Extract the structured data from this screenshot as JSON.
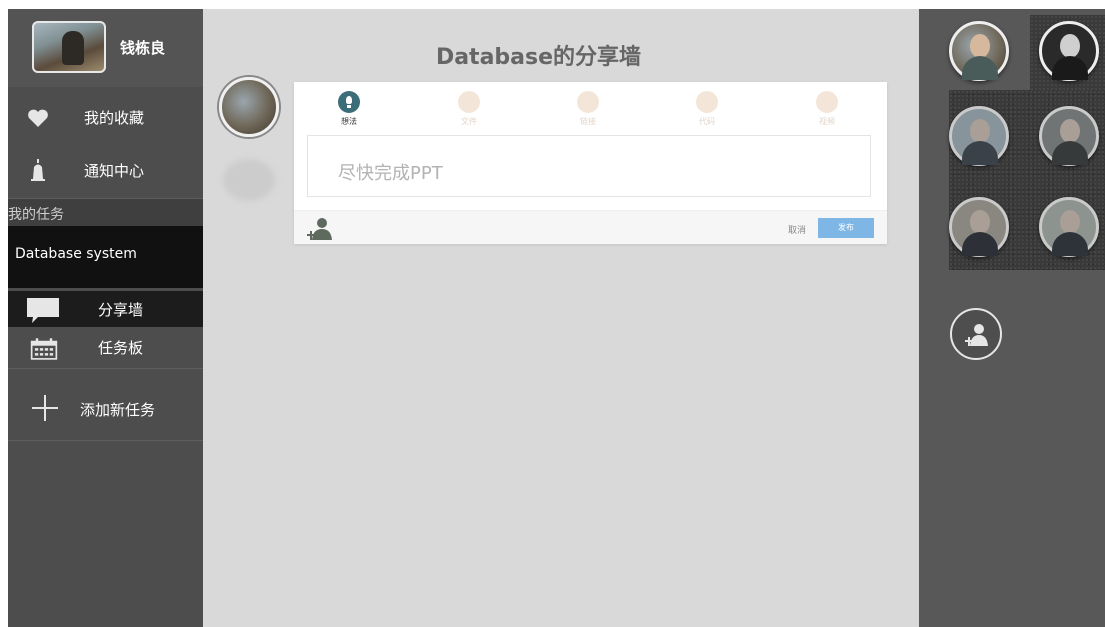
{
  "sidebar": {
    "user_name": "钱栋良",
    "favorites_label": "我的收藏",
    "notifications_label": "通知中心",
    "section_title": "我的任务",
    "active_task": "Database system",
    "share_wall_label": "分享墙",
    "task_board_label": "任务板",
    "add_task_label": "添加新任务"
  },
  "main": {
    "title": "Database的分享墙",
    "composer": {
      "tabs": [
        {
          "label": "想法",
          "icon": "lightbulb-icon",
          "active": true
        },
        {
          "label": "文件",
          "icon": "file-icon",
          "active": false
        },
        {
          "label": "链接",
          "icon": "link-icon",
          "active": false
        },
        {
          "label": "代码",
          "icon": "code-icon",
          "active": false
        },
        {
          "label": "视频",
          "icon": "video-icon",
          "active": false
        }
      ],
      "idea_text": "尽快完成PPT",
      "cancel_label": "取消",
      "publish_label": "发布"
    }
  },
  "colors": {
    "sidebar_bg": "#4d4d4d",
    "main_bg": "#d9d9d9",
    "right_panel_bg": "#585858",
    "active_tab": "#3c6e7a",
    "publish_button": "#7eb6e6"
  }
}
